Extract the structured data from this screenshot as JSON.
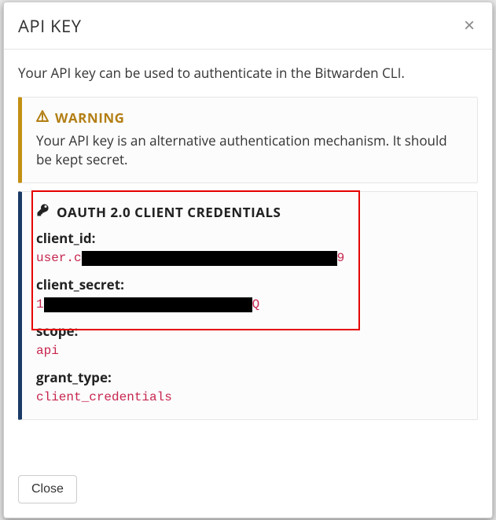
{
  "modal": {
    "title": "API KEY",
    "intro": "Your API key can be used to authenticate in the Bitwarden CLI."
  },
  "warning": {
    "label": "WARNING",
    "text": "Your API key is an alternative authentication mechanism. It should be kept secret."
  },
  "credentials": {
    "title": "OAUTH 2.0 CLIENT CREDENTIALS",
    "client_id_label": "client_id:",
    "client_id_prefix": "user.c",
    "client_id_suffix": "9",
    "client_secret_label": "client_secret:",
    "client_secret_prefix": "1",
    "client_secret_suffix": "Q",
    "scope_label": "scope:",
    "scope_value": "api",
    "grant_type_label": "grant_type:",
    "grant_type_value": "client_credentials"
  },
  "footer": {
    "close_label": "Close"
  }
}
